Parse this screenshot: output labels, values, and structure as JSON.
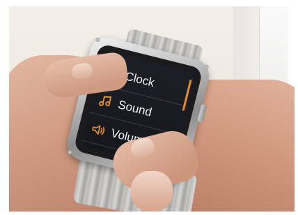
{
  "watch_menu": {
    "items": [
      {
        "label": "Clock",
        "icon": "clock-icon"
      },
      {
        "label": "Sound",
        "icon": "music-note-icon"
      },
      {
        "label": "Volum",
        "icon": "speaker-volume-icon"
      }
    ]
  },
  "colors": {
    "accent": "#e08a2e",
    "screen_background": "#1c1f26",
    "menu_text": "#f2f2f2"
  }
}
